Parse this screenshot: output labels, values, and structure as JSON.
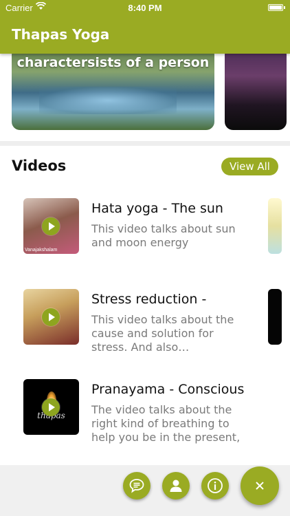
{
  "status_bar": {
    "carrier": "Carrier",
    "time": "8:40 PM"
  },
  "app_bar": {
    "title": "Thapas Yoga"
  },
  "carousel": {
    "items": [
      {
        "caption": "charactersists of a person"
      }
    ]
  },
  "videos": {
    "heading": "Videos",
    "view_all": "View All",
    "items": [
      {
        "title": "Hata yoga - The sun",
        "description": "This video talks about sun and moon energy",
        "thumb_tag": "Vanajakshalam"
      },
      {
        "title": "Stress reduction -",
        "description": "This video talks about the cause and solution for stress. And also…"
      },
      {
        "title": "Pranayama - Conscious",
        "description": "The video talks about the right kind of breathing to help you be in the present,",
        "thumb_brand": "thapas"
      }
    ]
  },
  "fab_actions": [
    {
      "icon": "chat-icon"
    },
    {
      "icon": "profile-icon"
    },
    {
      "icon": "info-icon"
    },
    {
      "icon": "close-icon"
    }
  ],
  "colors": {
    "accent": "#9aab23"
  }
}
